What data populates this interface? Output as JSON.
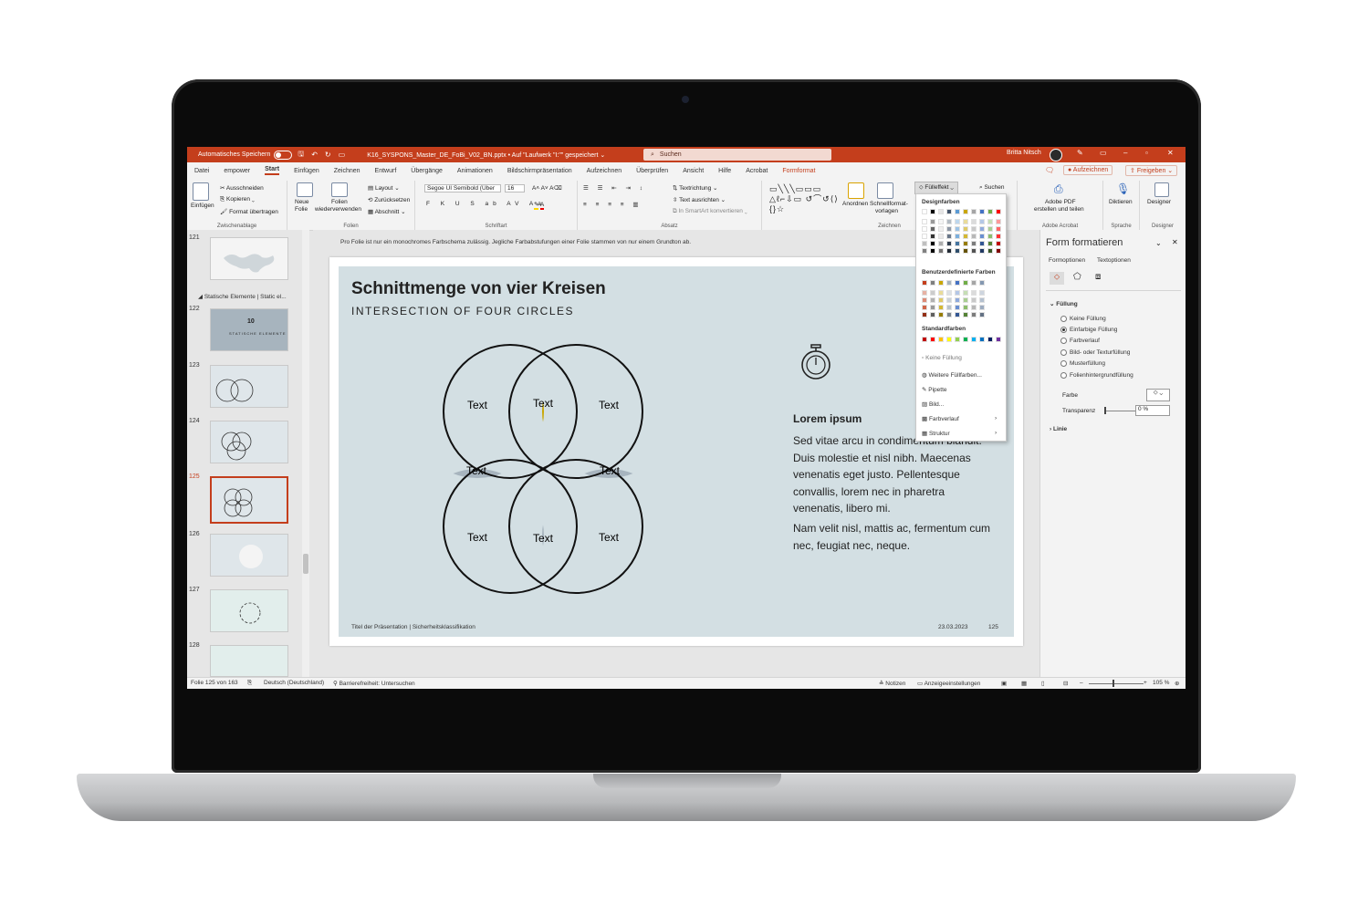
{
  "app": {
    "autosave_label": "Automatisches Speichern",
    "file_title": "K16_SYSPONS_Master_DE_FoBi_V02_BN.pptx • Auf \"Laufwerk \"I:\"\" gespeichert ⌄",
    "search_placeholder": "Suchen",
    "user_name": "Britta Nitsch"
  },
  "tabs": [
    "Datei",
    "empower",
    "Start",
    "Einfügen",
    "Zeichnen",
    "Entwurf",
    "Übergänge",
    "Animationen",
    "Bildschirmpräsentation",
    "Aufzeichnen",
    "Überprüfen",
    "Ansicht",
    "Hilfe",
    "Acrobat",
    "Formformat"
  ],
  "tab_buttons": {
    "record": "Aufzeichnen",
    "share": "Freigeben"
  },
  "ribbon": {
    "clipboard": {
      "paste": "Einfügen",
      "cut": "Ausschneiden",
      "copy": "Kopieren",
      "format": "Format übertragen",
      "label": "Zwischenablage"
    },
    "slides": {
      "new": "Neue",
      "new2": "Folie",
      "reuse": "Folien",
      "reuse2": "wiederverwenden",
      "layout": "Layout",
      "reset": "Zurücksetzen",
      "section": "Abschnitt",
      "label": "Folien"
    },
    "font": {
      "name": "Segoe UI Semibold (Über",
      "size": "16",
      "label": "Schriftart"
    },
    "paragraph": {
      "direction": "Textrichtung",
      "align": "Text ausrichten",
      "smartart": "In SmartArt konvertieren",
      "label": "Absatz"
    },
    "drawing": {
      "arrange": "Anordnen",
      "quick": "Schnellformat-",
      "quick2": "vorlagen",
      "fill": "Fülleffekt",
      "label": "Zeichnen"
    },
    "editing": {
      "search": "Suchen"
    },
    "acrobat": {
      "btn": "Adobe PDF",
      "btn2": "erstellen und teilen",
      "label": "Adobe Acrobat"
    },
    "voice": {
      "btn": "Diktieren",
      "label": "Sprache"
    },
    "designer": {
      "btn": "Designer",
      "label": "Designer"
    }
  },
  "thumbnails": {
    "numbers": [
      "121",
      "122",
      "123",
      "124",
      "125",
      "126",
      "127",
      "128"
    ],
    "section": "Statische Elemente | Static el...",
    "thumb122_num": "10",
    "thumb122_text": "STATISCHE ELEMENTE"
  },
  "slide": {
    "note": "Pro Folie ist nur ein monochromes Farbschema zulässig. Jegliche Farbabstufungen einer Folie stammen von nur einem Grundton ab.",
    "title": "Schnittmenge von vier Kreisen",
    "subtitle": "INTERSECTION OF FOUR CIRCLES",
    "venn_label": "Text",
    "lorem_head": "Lorem ipsum",
    "lorem_p1": "Sed vitae arcu in condimentum blandit. Duis molestie et nisl nibh. Maecenas venenatis eget justo. Pellentesque convallis, lorem nec in pharetra venenatis, libero mi.",
    "lorem_p2": "Nam velit nisl, mattis ac, fermentum cum nec, feugiat nec, neque.",
    "footer_title": "Titel der Präsentation | Sicherheitsklassifikation",
    "footer_date": "23.03.2023",
    "footer_page": "125"
  },
  "dropdown": {
    "design_colors": "Designfarben",
    "custom_colors": "Benutzerdefinierte Farben",
    "standard_colors": "Standardfarben",
    "no_fill": "Keine Füllung",
    "more_fill": "Weitere Füllfarben...",
    "eyedropper": "Pipette",
    "picture": "Bild...",
    "gradient": "Farbverlauf",
    "texture": "Struktur"
  },
  "format_pane": {
    "title": "Form formatieren",
    "tab_shape": "Formoptionen",
    "tab_text": "Textoptionen",
    "fill_section": "Füllung",
    "options": [
      "Keine Füllung",
      "Einfarbige Füllung",
      "Farbverlauf",
      "Bild- oder Texturfüllung",
      "Musterfüllung",
      "Folienhintergrundfüllung"
    ],
    "color_label": "Farbe",
    "transparency_label": "Transparenz",
    "transparency_value": "0 %",
    "line_section": "Linie"
  },
  "status": {
    "slide_count": "Folie 125 von 163",
    "language": "Deutsch (Deutschland)",
    "accessibility": "Barrierefreiheit: Untersuchen",
    "notes": "Notizen",
    "display": "Anzeigeeinstellungen",
    "zoom": "105 %"
  },
  "colors": {
    "accent": "#c43e1c",
    "venn_gold": "#c9a600",
    "venn_gray": "#a7b4be",
    "venn_light": "#e2e9ec",
    "slide_bg": "#d3dfe3",
    "design_palette": [
      "#ffffff",
      "#000000",
      "#e7e6e6",
      "#44546a",
      "#5b9bd5",
      "#c9a600",
      "#a5a5a5",
      "#4472c4",
      "#70ad47",
      "#ff0000"
    ],
    "custom_palette": [
      "#c43e1c",
      "#7f7f7f",
      "#c9a600",
      "#a7b4be",
      "#4472c4",
      "#70ad47",
      "#a5a5a5",
      "#8497b0"
    ],
    "standard_palette": [
      "#c00000",
      "#ff0000",
      "#ffc000",
      "#ffff00",
      "#92d050",
      "#00b050",
      "#00b0f0",
      "#0070c0",
      "#002060",
      "#7030a0"
    ]
  }
}
